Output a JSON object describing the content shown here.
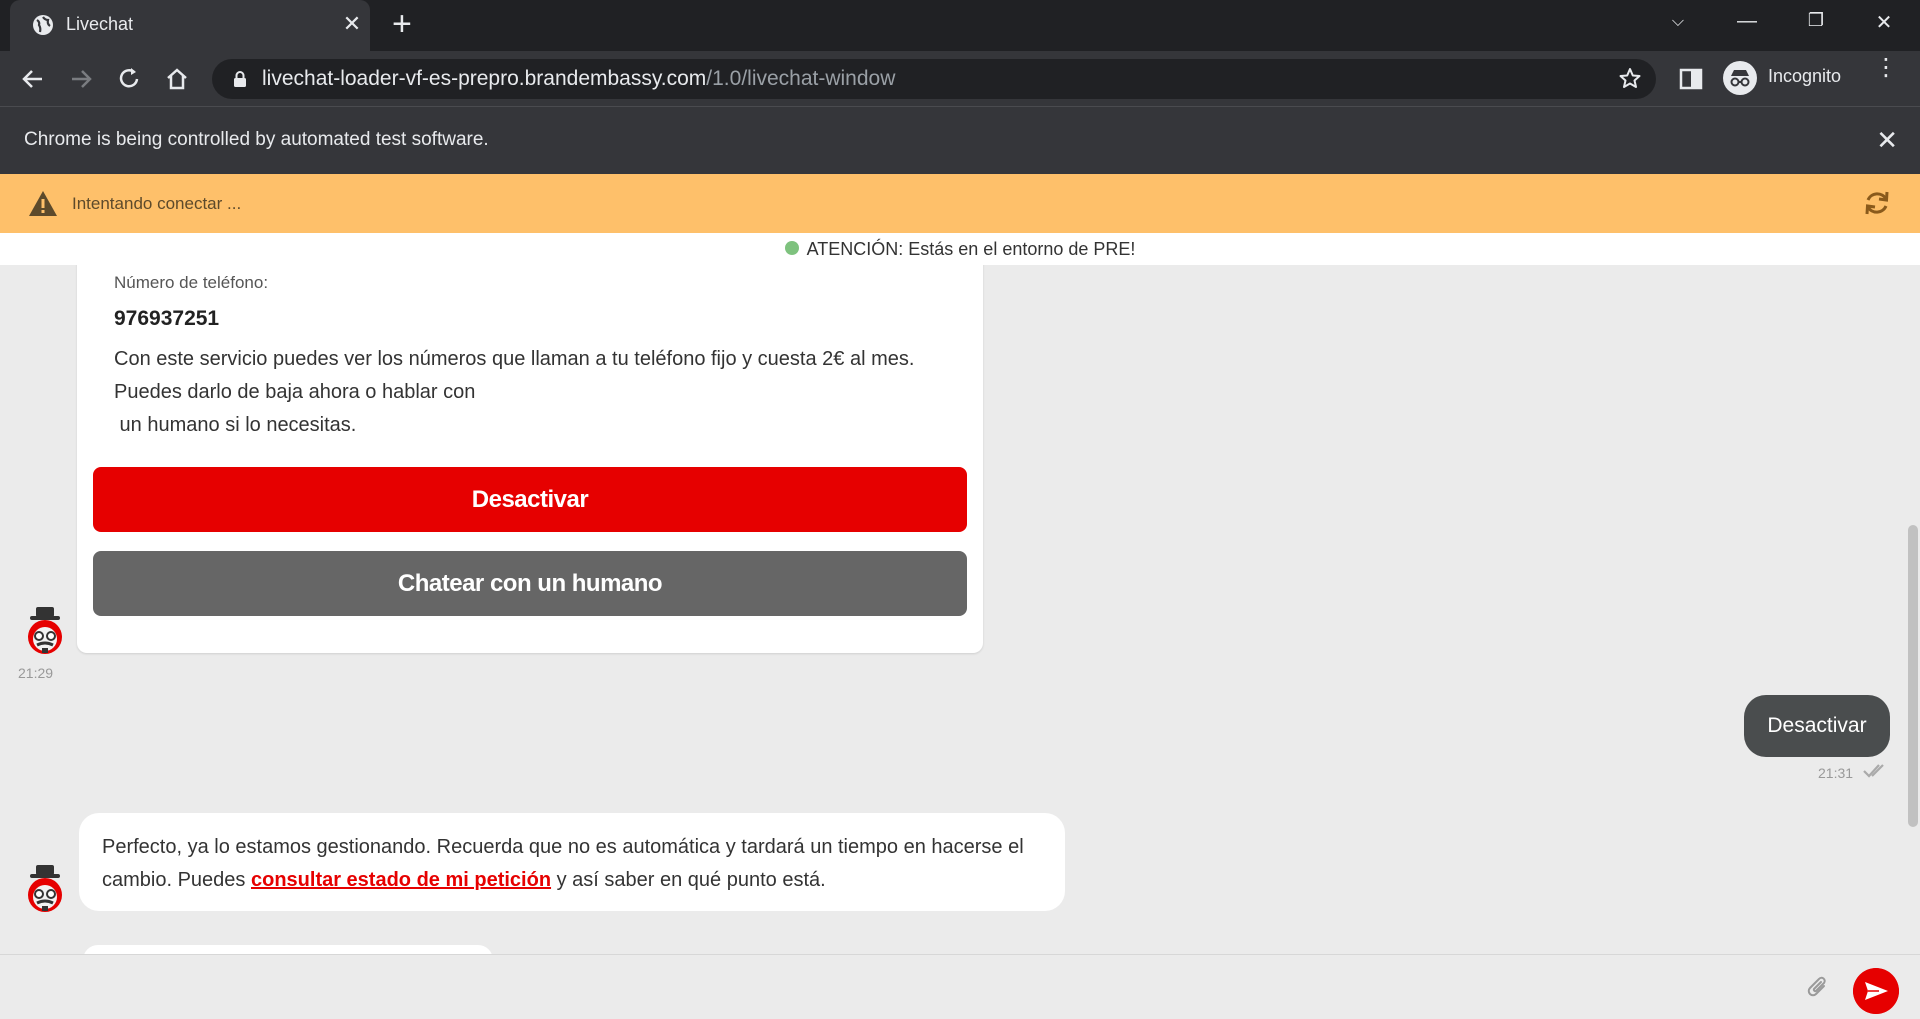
{
  "browser": {
    "tab_title": "Livechat",
    "url_host": "livechat-loader-vf-es-prepro.brandembassy.com",
    "url_path": "/1.0/livechat-window",
    "profile_label": "Incognito",
    "automation_notice": "Chrome is being controlled by automated test software."
  },
  "status": {
    "connecting_text": "Intentando conectar ...",
    "env_notice": "ATENCIÓN: Estás en el entorno de PRE!"
  },
  "messages": {
    "card": {
      "phone_label": "Número de teléfono:",
      "phone_number": "976937251",
      "description": "Con este servicio puedes ver los números que llaman a tu teléfono fijo y cuesta 2€ al mes.\nPuedes darlo de baja ahora o hablar con\n un humano si lo necesitas.",
      "deactivate_button": "Desactivar",
      "human_button": "Chatear con un humano",
      "time": "21:29"
    },
    "user_reply": {
      "text": "Desactivar",
      "time": "21:31"
    },
    "bot_reply": {
      "text_before_link": "Perfecto,  ya lo estamos gestionando. Recuerda que no es automática y tardará un tiempo en hacerse el cambio. Puedes ",
      "link_text": "consultar estado de mi petición",
      "text_after_link": " y así saber en qué punto está."
    }
  },
  "composer": {
    "placeholder": ""
  },
  "colors": {
    "brand_red": "#e60000",
    "warning_bg": "#fec06a",
    "user_bubble": "#4a4d4e",
    "secondary_button": "#666666"
  }
}
